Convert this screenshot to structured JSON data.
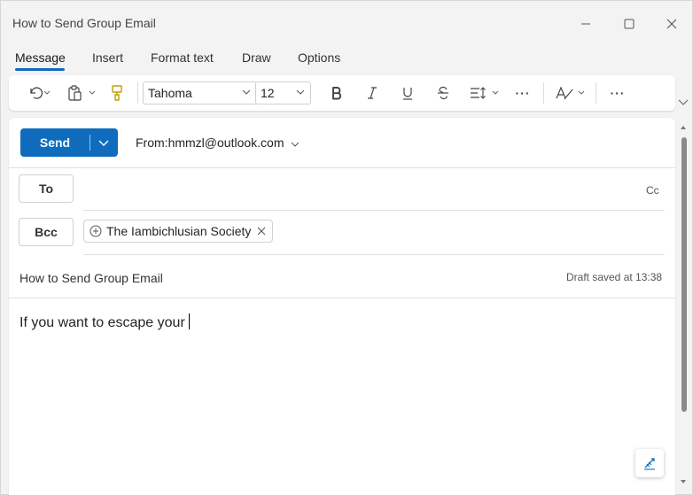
{
  "window": {
    "title": "How to Send Group Email"
  },
  "tabs": [
    {
      "label": "Message",
      "active": true
    },
    {
      "label": "Insert"
    },
    {
      "label": "Format text"
    },
    {
      "label": "Draw"
    },
    {
      "label": "Options"
    }
  ],
  "toolbar": {
    "font_name": "Tahoma",
    "font_size": "12",
    "more_label": "···"
  },
  "compose": {
    "send_label": "Send",
    "from_label": "From:",
    "from_address": "hmmzl@outlook.com",
    "to_label": "To",
    "cc_label": "Cc",
    "bcc_label": "Bcc",
    "bcc_recipient": "The Iambichlusian Society",
    "subject": "How to Send Group Email",
    "draft_status": "Draft saved at 13:38",
    "body": "If you want to escape your"
  },
  "colors": {
    "accent": "#0f6cbd",
    "background": "#f3f3f3",
    "surface": "#ffffff"
  },
  "icons": [
    "minimize-icon",
    "maximize-icon",
    "close-icon",
    "undo-icon",
    "paste-icon",
    "format-painter-icon",
    "bold-icon",
    "italic-icon",
    "underline-icon",
    "strikethrough-icon",
    "line-spacing-icon",
    "more-icon",
    "styles-icon",
    "add-contact-icon",
    "remove-icon",
    "signature-icon"
  ]
}
